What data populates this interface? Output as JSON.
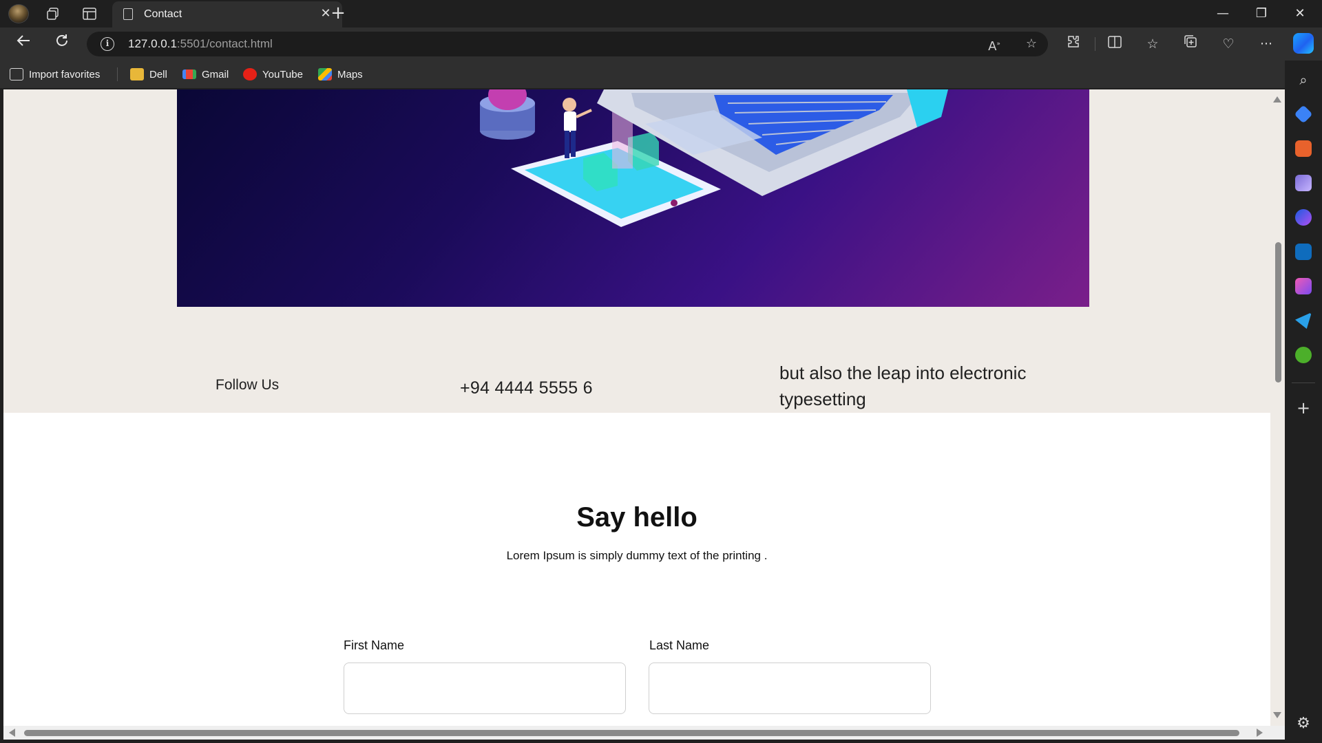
{
  "browser": {
    "tab_title": "Contact",
    "url_host": "127.0.0.1",
    "url_rest": ":5501/contact.html",
    "favorites": [
      {
        "label": "Import favorites"
      },
      {
        "label": "Dell"
      },
      {
        "label": "Gmail"
      },
      {
        "label": "YouTube"
      },
      {
        "label": "Maps"
      }
    ]
  },
  "info_row": {
    "follow": "Follow Us",
    "phone": "+94 4444 5555 6",
    "text": "but also the leap into electronic typesetting"
  },
  "contact": {
    "title": "Say hello",
    "subtitle": "Lorem Ipsum is simply dummy text of the printing .",
    "first_name_label": "First Name",
    "last_name_label": "Last Name"
  },
  "colors": {
    "page_band": "#efebe6",
    "hero_dark": "#0a0736",
    "hero_light": "#7a1f8a",
    "browser_dark": "#1f1f1f"
  }
}
